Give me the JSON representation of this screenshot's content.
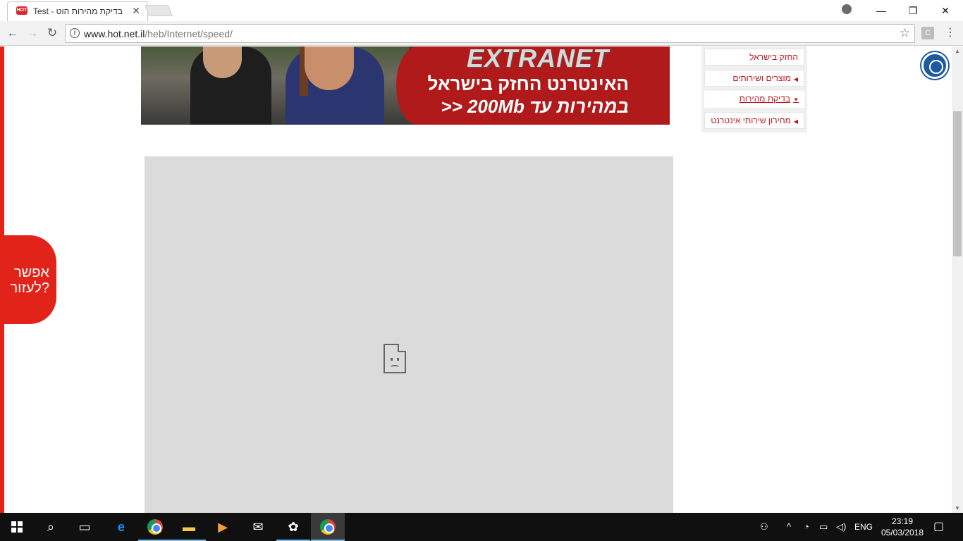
{
  "browser": {
    "tab": {
      "title": "Test - בדיקת מהירות הוט",
      "favicon_text": "HOT",
      "close_label": "✕"
    },
    "window_controls": {
      "minimize": "—",
      "restore": "❐",
      "close": "✕"
    },
    "toolbar": {
      "back": "←",
      "forward": "→",
      "reload": "↻",
      "url_host": "www.hot.net.il",
      "url_path": "/heb/Internet/speed/",
      "info_icon": "i",
      "bookmark_star": "☆",
      "extension_label": "C",
      "menu_label": "⋮"
    }
  },
  "page": {
    "help_tab": {
      "line1": "אפשר",
      "line2": "לעזור?"
    },
    "banner": {
      "brand": "EXTRANET",
      "line1": "האינטרנט החזק בישראל",
      "line2": "במהירות עד 200Mb <<"
    },
    "side_nav": {
      "items": [
        {
          "label": "החזק בישראל",
          "arrow": ""
        },
        {
          "label": "מוצרים ושירותים",
          "arrow": "◀"
        },
        {
          "label": "בדיקת מהירות",
          "arrow": "▼"
        },
        {
          "label": "מחירון שירותי אינטרנט",
          "arrow": "◀"
        }
      ]
    }
  },
  "taskbar": {
    "tray_language": "ENG",
    "clock_time": "23:19",
    "clock_date": "05/03/2018"
  },
  "colors": {
    "brand_red": "#e2231a",
    "nav_text_red": "#c0141b",
    "frame_gray": "#dbdbdb",
    "taskbar": "#101010"
  }
}
